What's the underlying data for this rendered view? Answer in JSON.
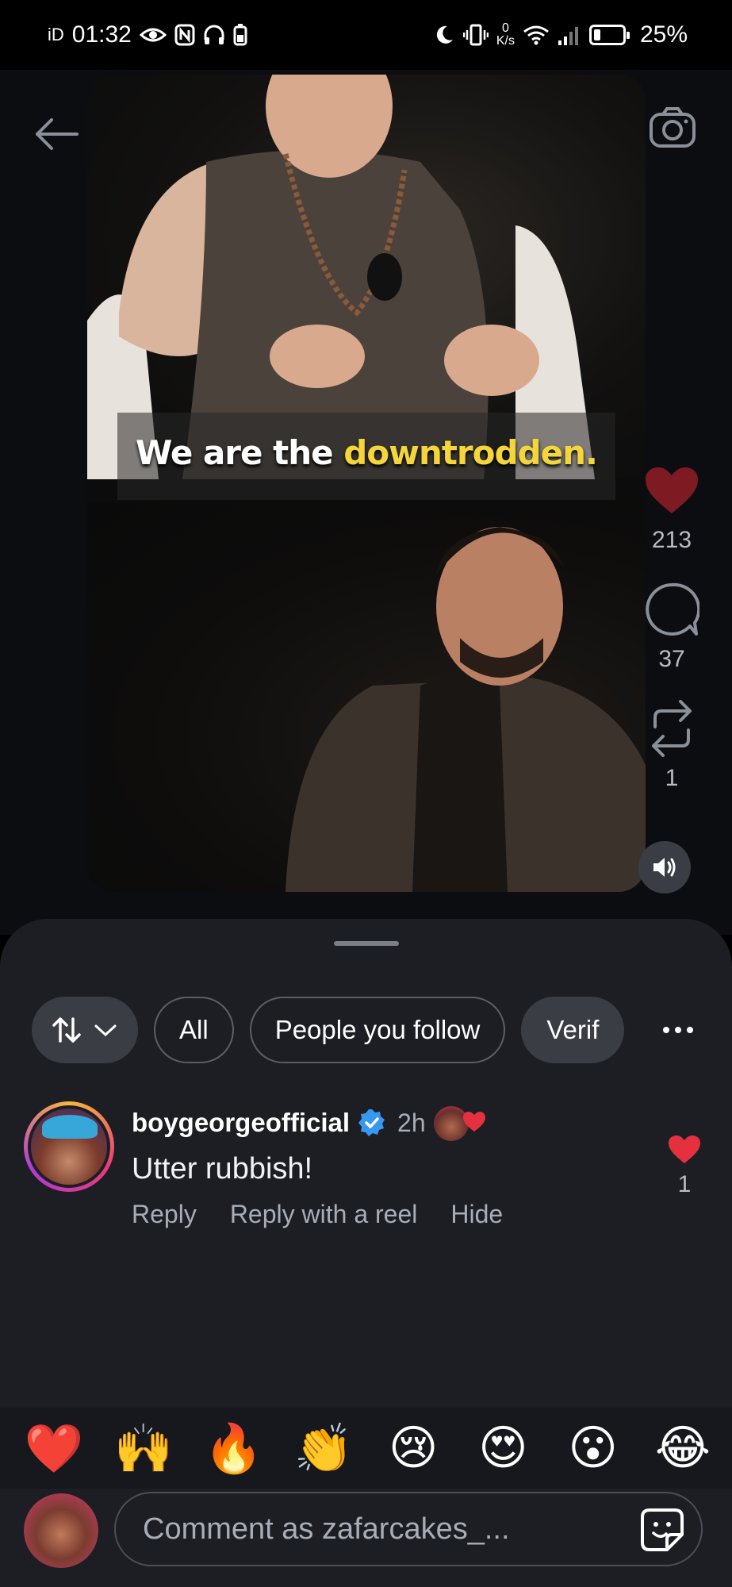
{
  "status_bar": {
    "carrier": "iD",
    "time": "01:32",
    "net_speed_value": "0",
    "net_speed_unit": "K/s",
    "battery": "25%",
    "battery_level": 0.25
  },
  "reel": {
    "caption_white": "We are the ",
    "caption_highlight": "downtrodden.",
    "likes": "213",
    "comments": "37",
    "reposts": "1"
  },
  "comments_sheet": {
    "filters": {
      "all": "All",
      "people_you_follow": "People you follow",
      "verified": "Verif"
    },
    "comment": {
      "username": "boygeorgeofficial",
      "time": "2h",
      "text": "Utter rubbish!",
      "reply": "Reply",
      "reply_with_reel": "Reply with a reel",
      "hide": "Hide",
      "like_count": "1"
    },
    "emojis": [
      "❤️",
      "🙌",
      "🔥",
      "👏",
      "😢",
      "😍",
      "😮",
      "😂"
    ],
    "composer": {
      "placeholder": "Comment as zafarcakes_..."
    }
  },
  "colors": {
    "like_red": "#e5303f",
    "liked_dark_red": "#7d1a22",
    "verified_blue": "#3897f0",
    "caption_highlight": "#f5d63a",
    "sheet_bg": "#1c1e24"
  }
}
